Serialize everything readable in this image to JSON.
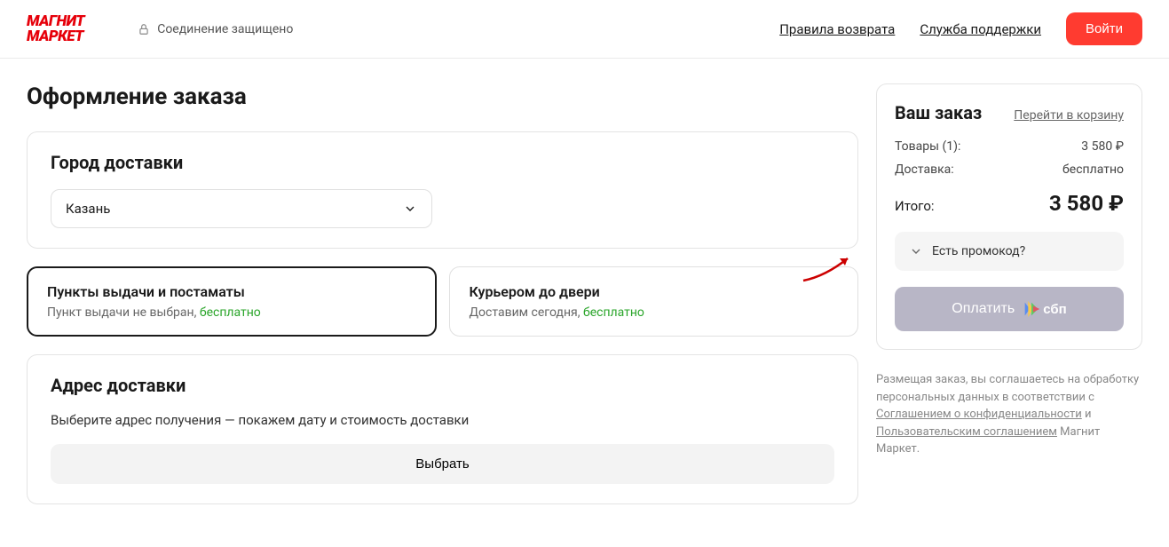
{
  "header": {
    "logo_line1": "МАГНИТ",
    "logo_line2": "МАРКЕТ",
    "secure_text": "Соединение защищено",
    "link_returns": "Правила возврата",
    "link_support": "Служба поддержки",
    "login": "Войти"
  },
  "page_title": "Оформление заказа",
  "city_section": {
    "title": "Город доставки",
    "value": "Казань"
  },
  "delivery": {
    "pickup": {
      "title": "Пункты выдачи и постаматы",
      "sub_prefix": "Пункт выдачи не выбран, ",
      "sub_free": "бесплатно"
    },
    "courier": {
      "title": "Курьером до двери",
      "sub_prefix": "Доставим сегодня, ",
      "sub_free": "бесплатно"
    }
  },
  "address": {
    "title": "Адрес доставки",
    "hint": "Выберите адрес получения — покажем дату и стоимость доставки",
    "choose": "Выбрать"
  },
  "order": {
    "title": "Ваш заказ",
    "cart_link": "Перейти в корзину",
    "items_label": "Товары (1):",
    "items_value": "3 580 ₽",
    "delivery_label": "Доставка:",
    "delivery_value": "бесплатно",
    "total_label": "Итого:",
    "total_value": "3 580 ₽",
    "promo": "Есть промокод?",
    "pay": "Оплатить",
    "sbp": "сбп"
  },
  "legal": {
    "t1": "Размещая заказ, вы соглашаетесь на обработку персональных данных в соответствии с ",
    "l1": "Соглашением о конфиденциальности",
    "t2": " и ",
    "l2": "Пользовательским соглашением",
    "t3": " Магнит Маркет."
  }
}
